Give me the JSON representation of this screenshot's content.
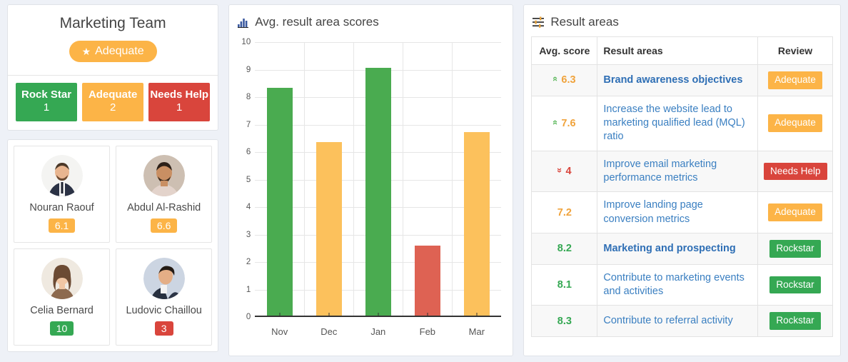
{
  "team": {
    "title": "Marketing Team",
    "rating_pill": {
      "label": "Adequate",
      "icon": "star-icon",
      "color": "#fcb447"
    },
    "stats": [
      {
        "label": "Rock Star",
        "count": "1",
        "color": "#35a853"
      },
      {
        "label": "Adequate",
        "count": "2",
        "color": "#fcb447"
      },
      {
        "label": "Needs Help",
        "count": "1",
        "color": "#d9453c"
      }
    ],
    "members": [
      {
        "name": "Nouran Raouf",
        "score": "6.1",
        "score_color": "#fcb447"
      },
      {
        "name": "Abdul Al-Rashid",
        "score": "6.6",
        "score_color": "#fcb447"
      },
      {
        "name": "Celia Bernard",
        "score": "10",
        "score_color": "#35a853"
      },
      {
        "name": "Ludovic Chaillou",
        "score": "3",
        "score_color": "#d9453c"
      }
    ]
  },
  "chart_panel": {
    "title": "Avg. result area scores",
    "icon": "bar-chart-icon"
  },
  "chart_data": {
    "type": "bar",
    "title": "Avg. result area scores",
    "xlabel": "",
    "ylabel": "",
    "ylim": [
      0,
      10
    ],
    "yticks": [
      "0",
      "1",
      "2",
      "3",
      "4",
      "5",
      "6",
      "7",
      "8",
      "9",
      "10"
    ],
    "grid": true,
    "legend": "none",
    "categories": [
      "Nov",
      "Dec",
      "Jan",
      "Feb",
      "Mar"
    ],
    "values": [
      8.35,
      6.37,
      9.07,
      2.6,
      6.72
    ],
    "colors": [
      "#4aab50",
      "#fcc15c",
      "#4aab50",
      "#de6253",
      "#fcc15c"
    ]
  },
  "result_areas": {
    "title": "Result areas",
    "icon": "sliders-icon",
    "columns": [
      "Avg. score",
      "Result areas",
      "Review"
    ],
    "rows": [
      {
        "score": "6.3",
        "score_color": "#f0a33c",
        "trend": "up",
        "area": "Brand awareness objectives",
        "bold": true,
        "review": "Adequate",
        "review_color": "#fcb447"
      },
      {
        "score": "7.6",
        "score_color": "#f0a33c",
        "trend": "up",
        "area": "Increase the website lead to marketing qualified lead (MQL) ratio",
        "bold": false,
        "review": "Adequate",
        "review_color": "#fcb447"
      },
      {
        "score": "4",
        "score_color": "#d9453c",
        "trend": "down",
        "area": "Improve email marketing performance metrics",
        "bold": false,
        "review": "Needs Help",
        "review_color": "#d9453c"
      },
      {
        "score": "7.2",
        "score_color": "#f0a33c",
        "trend": "none",
        "area": "Improve landing page conversion metrics",
        "bold": false,
        "review": "Adequate",
        "review_color": "#fcb447"
      },
      {
        "score": "8.2",
        "score_color": "#35a853",
        "trend": "none",
        "area": "Marketing and prospecting",
        "bold": true,
        "review": "Rockstar",
        "review_color": "#35a853"
      },
      {
        "score": "8.1",
        "score_color": "#35a853",
        "trend": "none",
        "area": "Contribute to marketing events and activities",
        "bold": false,
        "review": "Rockstar",
        "review_color": "#35a853"
      },
      {
        "score": "8.3",
        "score_color": "#35a853",
        "trend": "none",
        "area": "Contribute to referral activity",
        "bold": false,
        "review": "Rockstar",
        "review_color": "#35a853"
      }
    ]
  }
}
